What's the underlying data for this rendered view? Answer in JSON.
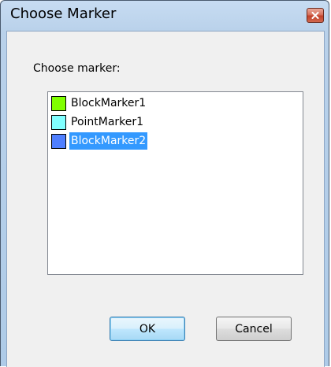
{
  "dialog": {
    "title": "Choose Marker",
    "prompt": "Choose marker:",
    "close_icon": "close-icon"
  },
  "markers": [
    {
      "label": "BlockMarker1",
      "color": "#80ff00",
      "selected": false
    },
    {
      "label": "PointMarker1",
      "color": "#80ffff",
      "selected": false
    },
    {
      "label": "BlockMarker2",
      "color": "#4f7fff",
      "selected": true
    }
  ],
  "buttons": {
    "ok_label": "OK",
    "cancel_label": "Cancel"
  },
  "colors": {
    "selection": "#3399ff",
    "close_button": "#c7442c"
  }
}
